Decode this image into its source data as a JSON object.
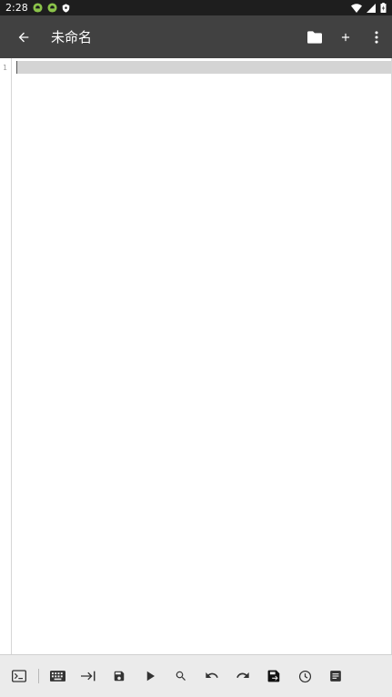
{
  "status_bar": {
    "time": "2:28",
    "icons": [
      "android-icon",
      "android-icon",
      "shield-icon",
      "wifi-icon",
      "signal-icon",
      "battery-icon"
    ]
  },
  "app_bar": {
    "title": "未命名",
    "icons": [
      "back-arrow-icon",
      "folder-icon",
      "plus-icon",
      "more-vert-icon"
    ],
    "background": "#414141"
  },
  "editor": {
    "line_numbers": [
      "1"
    ],
    "content": "",
    "current_line_color": "#d4d4d4"
  },
  "toolbar": {
    "icons": [
      "terminal-icon",
      "keyboard-icon",
      "tab-indent-icon",
      "save-icon",
      "run-icon",
      "search-icon",
      "undo-icon",
      "redo-icon",
      "save-as-icon",
      "history-icon",
      "document-icon"
    ],
    "background": "#ebebeb"
  }
}
